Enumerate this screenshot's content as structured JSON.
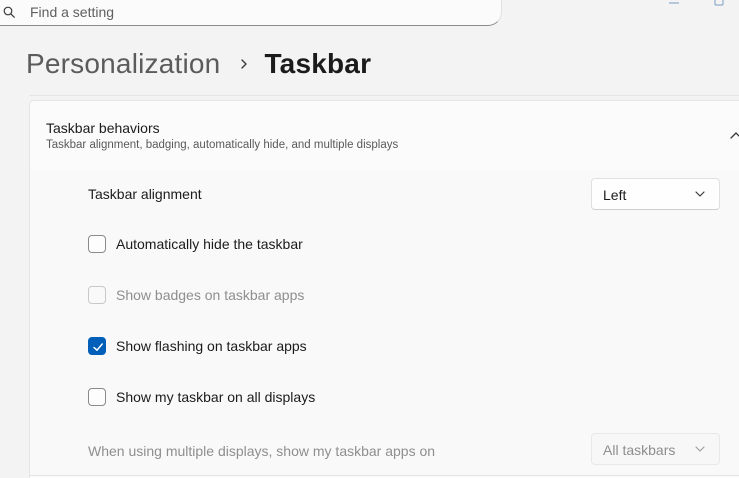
{
  "search": {
    "placeholder": "Find a setting"
  },
  "breadcrumb": {
    "parent": "Personalization",
    "current": "Taskbar"
  },
  "section": {
    "title": "Taskbar behaviors",
    "subtitle": "Taskbar alignment, badging, automatically hide, and multiple displays",
    "expanded": true
  },
  "settings": {
    "alignment": {
      "label": "Taskbar alignment",
      "value": "Left"
    },
    "auto_hide": {
      "label": "Automatically hide the taskbar",
      "checked": false,
      "enabled": true
    },
    "badges": {
      "label": "Show badges on taskbar apps",
      "checked": false,
      "enabled": false
    },
    "flashing": {
      "label": "Show flashing on taskbar apps",
      "checked": true,
      "enabled": true
    },
    "all_displays": {
      "label": "Show my taskbar on all displays",
      "checked": false,
      "enabled": true
    },
    "multi_display_apps": {
      "label": "When using multiple displays, show my taskbar apps on",
      "value": "All taskbars",
      "enabled": false
    }
  },
  "colors": {
    "accent": "#005fb8",
    "background": "#f3f3f3",
    "card": "#fbfbfb",
    "disabled_text": "#8e8e8e"
  },
  "icons": {
    "search": "search-icon",
    "breadcrumb_separator": "chevron-right-icon",
    "collapse": "chevron-up-icon",
    "dropdown": "chevron-down-icon",
    "checkmark": "checkmark-icon",
    "minimize": "minimize-icon",
    "maximize": "maximize-icon"
  }
}
